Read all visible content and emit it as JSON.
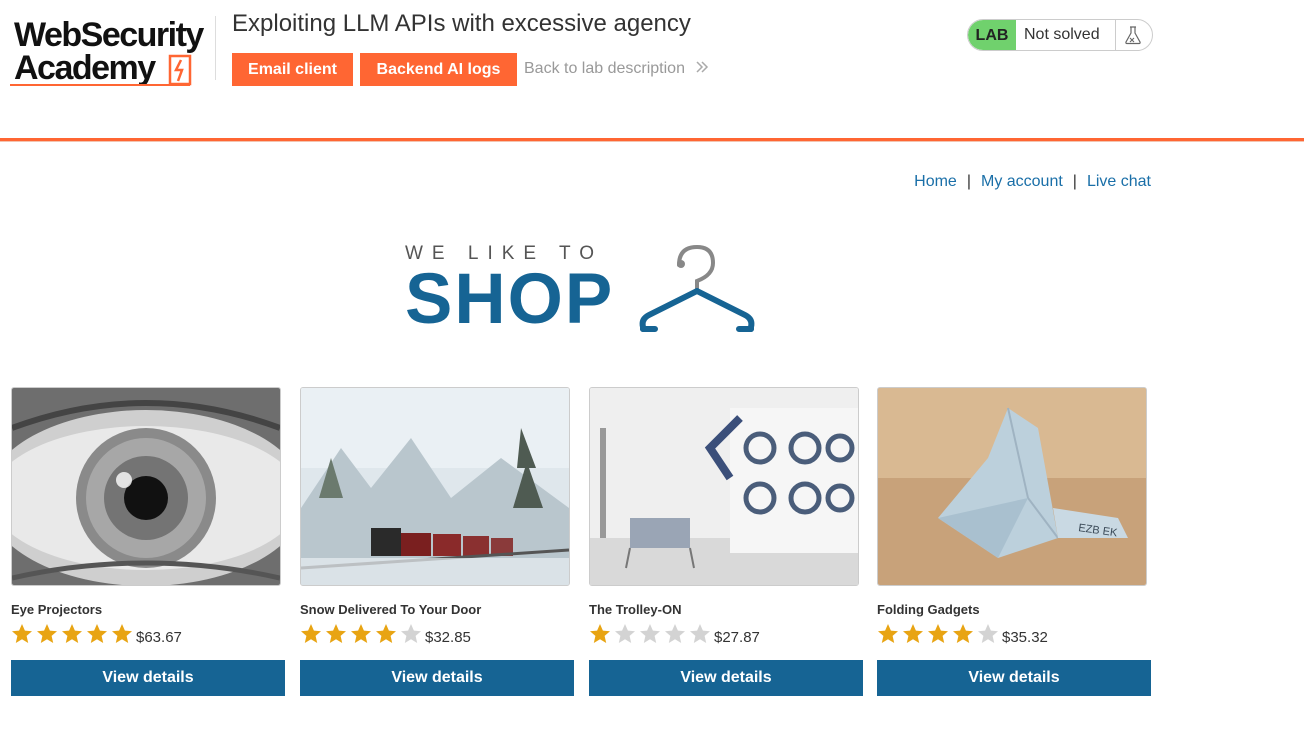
{
  "header": {
    "logo_line1": "WebSecurity",
    "logo_line2": "Academy",
    "lab_title": "Exploiting LLM APIs with excessive agency",
    "email_client_label": "Email client",
    "backend_logs_label": "Backend AI logs",
    "back_link_label": "Back to lab description",
    "lab_badge": "LAB",
    "lab_status": "Not solved"
  },
  "nav": {
    "home": "Home",
    "my_account": "My account",
    "live_chat": "Live chat",
    "separator": "|"
  },
  "banner": {
    "small_text": "WE LIKE TO",
    "big_text": "SHOP"
  },
  "products": [
    {
      "name": "Eye Projectors",
      "rating": 5,
      "price": "$63.67",
      "button": "View details"
    },
    {
      "name": "Snow Delivered To Your Door",
      "rating": 4,
      "price": "$32.85",
      "button": "View details"
    },
    {
      "name": "The Trolley-ON",
      "rating": 1,
      "price": "$27.87",
      "button": "View details"
    },
    {
      "name": "Folding Gadgets",
      "rating": 4,
      "price": "$35.32",
      "button": "View details"
    }
  ],
  "colors": {
    "accent_orange": "#ff6633",
    "brand_blue": "#166494",
    "link_blue": "#1a6fa8",
    "lab_green": "#70d16d",
    "star_gold": "#e8a413",
    "star_grey": "#d3d3d3"
  }
}
